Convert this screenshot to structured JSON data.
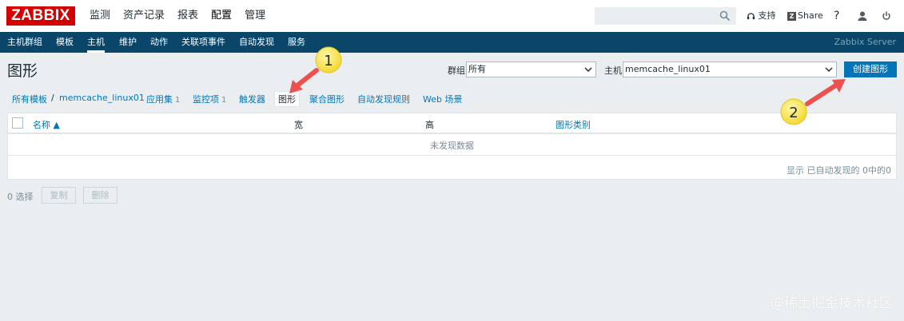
{
  "logo": "ZABBIX",
  "top_nav": [
    {
      "label": "监测"
    },
    {
      "label": "资产记录"
    },
    {
      "label": "报表"
    },
    {
      "label": "配置"
    },
    {
      "label": "管理"
    }
  ],
  "search": {
    "value": "",
    "placeholder": ""
  },
  "top_right": {
    "support": "支持",
    "share": "Share",
    "help": "?"
  },
  "sub_nav": [
    {
      "label": "主机群组"
    },
    {
      "label": "模板"
    },
    {
      "label": "主机"
    },
    {
      "label": "维护"
    },
    {
      "label": "动作"
    },
    {
      "label": "关联项事件"
    },
    {
      "label": "自动发现"
    },
    {
      "label": "服务"
    }
  ],
  "server_name": "Zabbix Server",
  "page": {
    "title": "图形"
  },
  "filters": {
    "group_label": "群组",
    "group_value": "所有",
    "host_label": "主机",
    "host_value": "memcache_linux01"
  },
  "create_button": "创建图形",
  "breadcrumb": {
    "all_templates": "所有模板",
    "separator": "/",
    "host": "memcache_linux01",
    "tabs": [
      {
        "label": "应用集",
        "count": "1"
      },
      {
        "label": "监控项",
        "count": "1"
      },
      {
        "label": "触发器",
        "count": ""
      },
      {
        "label": "图形",
        "count": ""
      },
      {
        "label": "聚合图形",
        "count": ""
      },
      {
        "label": "自动发现规则",
        "count": ""
      },
      {
        "label": "Web 场景",
        "count": ""
      }
    ]
  },
  "table": {
    "columns": [
      "名称 ▲",
      "宽",
      "高",
      "图形类别"
    ],
    "empty_message": "未发现数据",
    "summary": "显示 已自动发现的 0中的0"
  },
  "footer": {
    "selected": "0 选择",
    "copy": "复制",
    "delete": "删除"
  },
  "annotations": {
    "step1": "1",
    "step2": "2"
  },
  "watermark": "@稀土掘金技术社区",
  "colors": {
    "brand_red": "#d40000",
    "subnav_bg": "#0a466a",
    "link_blue": "#0275b8",
    "arrow_red": "#ee4f4f",
    "badge_yellow": "#f7e44a"
  }
}
